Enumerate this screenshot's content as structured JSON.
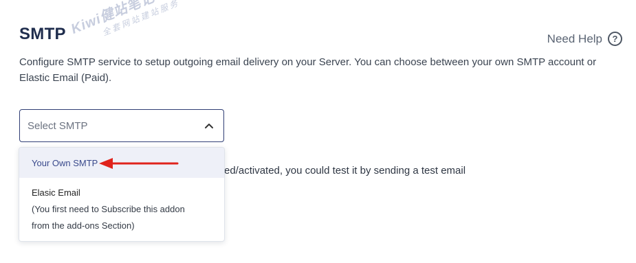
{
  "page": {
    "title": "SMTP",
    "help_label": "Need Help",
    "help_icon": "question-circle-icon",
    "description": "Configure SMTP service to setup outgoing email delivery on your Server. You can choose between your own SMTP account or Elastic Email (Paid)."
  },
  "watermark": {
    "main": "Kiwi健站笔记",
    "sub": "全套网站建站服务"
  },
  "select": {
    "placeholder": "Select SMTP",
    "icon": "chevron-up-icon"
  },
  "dropdown": {
    "options": [
      {
        "label": "Your Own SMTP",
        "highlighted": true
      },
      {
        "label": "Elasic Email",
        "note_line1": "(You first need to Subscribe this addon",
        "note_line2": "from the add-ons Section)"
      }
    ]
  },
  "hidden_text": "ed/activated, you could test it by sending a test email",
  "annotation": {
    "arrow_color": "#e0231c"
  }
}
